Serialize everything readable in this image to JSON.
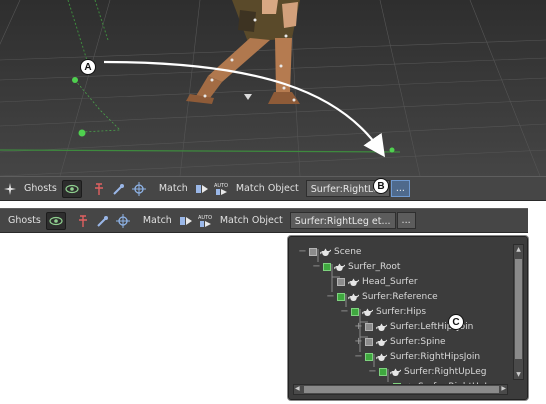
{
  "toolbar": {
    "ghosts_label": "Ghosts",
    "match_label": "Match",
    "match_object_label": "Match Object",
    "auto_label": "AUTO",
    "ellipsis_label": "..."
  },
  "toolbar_top": {
    "match_object_value": "Surfer:RightLeg"
  },
  "toolbar_bottom": {
    "match_object_value": "Surfer:RightLeg et..."
  },
  "callouts": {
    "a": "A",
    "b": "B",
    "c": "C"
  },
  "scene_tree": {
    "items": [
      {
        "label": "Scene",
        "expander": "−",
        "checked": false
      },
      {
        "label": "Surfer_Root",
        "expander": "−",
        "checked": true
      },
      {
        "label": "Head_Surfer",
        "expander": "",
        "checked": false
      },
      {
        "label": "Surfer:Reference",
        "expander": "−",
        "checked": true
      },
      {
        "label": "Surfer:Hips",
        "expander": "−",
        "checked": true
      },
      {
        "label": "Surfer:LeftHipsJoin",
        "expander": "+",
        "checked": false
      },
      {
        "label": "Surfer:Spine",
        "expander": "+",
        "checked": false
      },
      {
        "label": "Surfer:RightHipsJoin",
        "expander": "−",
        "checked": true
      },
      {
        "label": "Surfer:RightUpLeg",
        "expander": "−",
        "checked": true
      },
      {
        "label": "Surfer:RightUpLeg",
        "expander": "−",
        "checked": true
      }
    ]
  },
  "colors": {
    "viewport_bg": "#3a3a3a",
    "toolbar_bg": "#464646",
    "check_green": "#3fa83f",
    "grid_green": "#3e8a3e"
  },
  "icons": {
    "ghosts": "eye-icon",
    "pin": "pin-icon",
    "dropper": "eyedropper-icon",
    "target": "crosshair-icon",
    "match": "match-icon",
    "auto_match": "auto-match-icon",
    "tree_node": "teapot-icon"
  }
}
